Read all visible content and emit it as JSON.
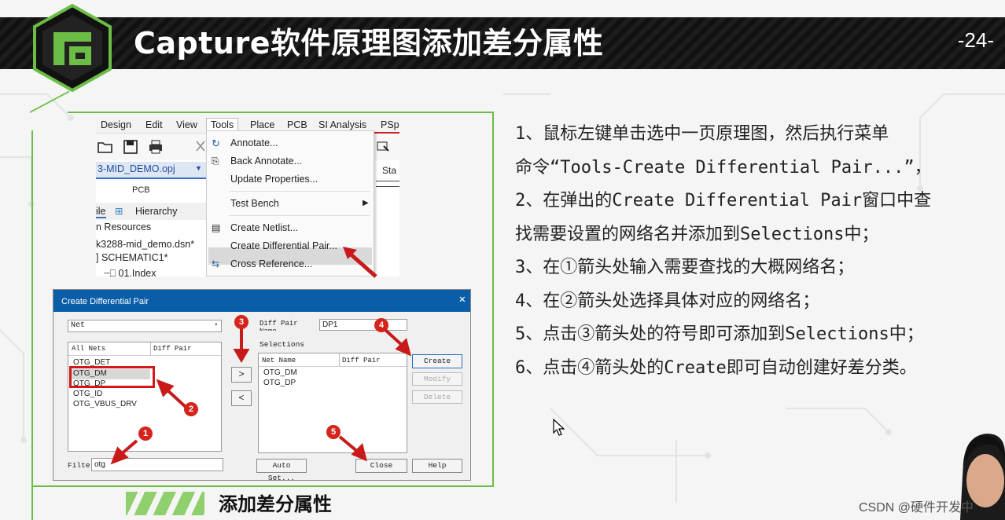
{
  "header": {
    "title": "Capture软件原理图添加差分属性",
    "page_number": "-24-"
  },
  "caption": "添加差分属性",
  "menu_screenshot": {
    "menubar": [
      "Design",
      "Edit",
      "View",
      "Tools",
      "Place",
      "PCB",
      "SI Analysis",
      "PSp"
    ],
    "active_menu": "Tools",
    "project_tab": "3-MID_DEMO.opj",
    "pcb_label": "PCB",
    "file_tab": "ile",
    "hierarchy_tab": "Hierarchy",
    "tree": [
      "n Resources",
      "k3288-mid_demo.dsn*",
      "] SCHEMATIC1*",
      "01.Index"
    ],
    "right_clip": "Sta",
    "tools_menu": [
      {
        "label": "Annotate...",
        "icon": "annotate-icon"
      },
      {
        "label": "Back Annotate...",
        "icon": "back-annotate-icon"
      },
      {
        "label": "Update Properties...",
        "icon": ""
      },
      {
        "label": "Test Bench",
        "icon": "",
        "submenu": true
      },
      {
        "label": "Create Netlist...",
        "icon": "netlist-icon"
      },
      {
        "label": "Create Differential Pair...",
        "icon": "",
        "highlighted": true
      },
      {
        "label": "Cross Reference...",
        "icon": "cross-ref-icon"
      }
    ]
  },
  "dialog": {
    "title": "Create Differential Pair",
    "filter_combo": "Net",
    "all_nets_header": "All Nets",
    "diff_pair_header": "Diff Pair",
    "nets": [
      "OTG_DET",
      "OTG_DM",
      "OTG_DP",
      "OTG_ID",
      "OTG_VBUS_DRV"
    ],
    "add_button": ">",
    "remove_button": "<",
    "diff_pair_name_label": "Diff Pair Name",
    "diff_pair_name_value": "DP1",
    "selections_label": "Selections",
    "net_name_header": "Net Name",
    "selections_diff_pair_header": "Diff Pair",
    "selections": [
      "OTG_DM",
      "OTG_DP"
    ],
    "create_button": "Create",
    "modify_button": "Modify",
    "delete_button": "Delete",
    "filter_label": "Filte",
    "filter_value": "otg",
    "auto_setup_button": "Auto Set...",
    "close_button": "Close",
    "help_button": "Help",
    "badges": [
      "1",
      "2",
      "3",
      "4",
      "5"
    ]
  },
  "instructions": [
    "1、鼠标左键单击选中一页原理图，然后执行菜单",
    "命令“Tools-Create Differential Pair...”，",
    "2、在弹出的Create Differential Pair窗口中查",
    "找需要设置的网络名并添加到Selections中；",
    "3、在①箭头处输入需要查找的大概网络名；",
    "4、在②箭头处选择具体对应的网络名；",
    "5、点击③箭头处的符号即可添加到Selections中；",
    "6、点击④箭头处的Create即可自动创建好差分类。"
  ],
  "watermark": "CSDN @硬件开发中",
  "colors": {
    "accent_green": "#6cbd45",
    "header_dark": "#151515",
    "marker_red": "#d4241c",
    "dialog_title_blue": "#0a5ea8"
  }
}
